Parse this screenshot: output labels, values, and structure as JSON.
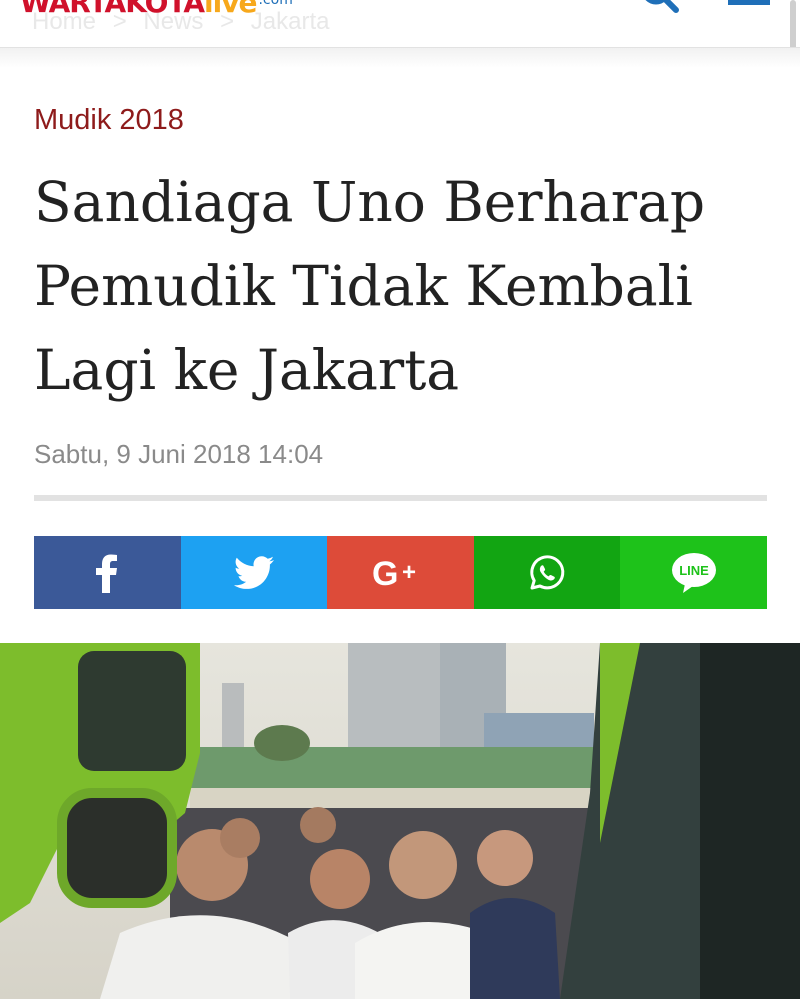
{
  "header": {
    "logo_brand": "WARTAKOTA",
    "logo_live": "live",
    "logo_domain": ".com",
    "breadcrumb": [
      "Home",
      ">",
      "News",
      ">",
      "Jakarta"
    ]
  },
  "article": {
    "category": "Mudik 2018",
    "headline_lines": [
      "Sandiaga Uno Berharap",
      "Pemudik Tidak Kembali",
      "Lagi ke Jakarta"
    ],
    "datetime": "Sabtu, 9 Juni 2018 14:04"
  },
  "share": {
    "buttons": [
      {
        "network": "facebook",
        "icon": "facebook-icon",
        "color": "#3b5998"
      },
      {
        "network": "twitter",
        "icon": "twitter-icon",
        "color": "#1da1f2"
      },
      {
        "network": "google-plus",
        "icon": "google-plus-icon",
        "color": "#dd4b39"
      },
      {
        "network": "whatsapp",
        "icon": "whatsapp-icon",
        "color": "#12a512"
      },
      {
        "network": "line",
        "icon": "line-icon",
        "color": "#1ec21a",
        "label": "LINE"
      }
    ]
  },
  "colors": {
    "category": "#8e1b1b",
    "headline": "#222222",
    "datetime": "#8a8a8a"
  }
}
